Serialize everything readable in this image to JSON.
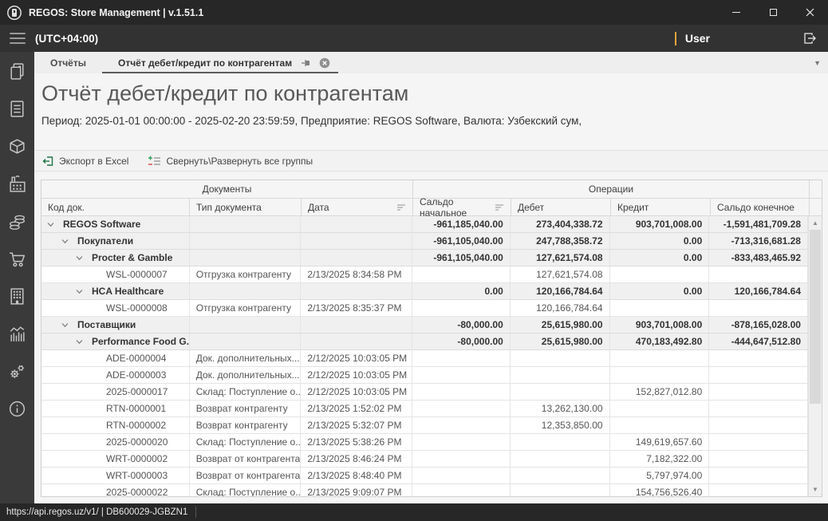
{
  "titlebar": {
    "title": "REGOS: Store Management | v.1.51.1"
  },
  "menubar": {
    "timezone": "(UTC+04:00)",
    "user": "User"
  },
  "tabs": [
    {
      "label": "Отчёты"
    },
    {
      "label": "Отчёт дебет/кредит по контрагентам",
      "active": true
    }
  ],
  "page": {
    "title": "Отчёт дебет/кредит по контрагентам",
    "subtitle": "Период: 2025-01-01 00:00:00 - 2025-02-20 23:59:59, Предприятие: REGOS Software, Валюта: Узбекский сум,"
  },
  "toolbar": {
    "export_label": "Экспорт в Excel",
    "collapse_label": "Свернуть\\Развернуть все группы"
  },
  "grid": {
    "bands": [
      "Документы",
      "Операции"
    ],
    "columns": [
      "Код док.",
      "Тип документа",
      "Дата",
      "Сальдо начальное",
      "Дебет",
      "Кредит",
      "Сальдо конечное"
    ],
    "rows": [
      {
        "level": 1,
        "group": true,
        "code": "REGOS Software",
        "doc_type": "",
        "date": "",
        "opening": "-961,185,040.00",
        "debit": "273,404,338.72",
        "credit": "903,701,008.00",
        "closing": "-1,591,481,709.28"
      },
      {
        "level": 2,
        "group": true,
        "code": "Покупатели",
        "doc_type": "",
        "date": "",
        "opening": "-961,105,040.00",
        "debit": "247,788,358.72",
        "credit": "0.00",
        "closing": "-713,316,681.28"
      },
      {
        "level": 3,
        "group": true,
        "code": "Procter & Gamble",
        "doc_type": "",
        "date": "",
        "opening": "-961,105,040.00",
        "debit": "127,621,574.08",
        "credit": "0.00",
        "closing": "-833,483,465.92"
      },
      {
        "level": 4,
        "group": false,
        "code": "WSL-0000007",
        "doc_type": "Отгрузка контрагенту",
        "date": "2/13/2025 8:34:58 PM",
        "opening": "",
        "debit": "127,621,574.08",
        "credit": "",
        "closing": ""
      },
      {
        "level": 3,
        "group": true,
        "code": "HCA Healthcare",
        "doc_type": "",
        "date": "",
        "opening": "0.00",
        "debit": "120,166,784.64",
        "credit": "0.00",
        "closing": "120,166,784.64"
      },
      {
        "level": 4,
        "group": false,
        "code": "WSL-0000008",
        "doc_type": "Отгрузка контрагенту",
        "date": "2/13/2025 8:35:37 PM",
        "opening": "",
        "debit": "120,166,784.64",
        "credit": "",
        "closing": ""
      },
      {
        "level": 2,
        "group": true,
        "code": "Поставщики",
        "doc_type": "",
        "date": "",
        "opening": "-80,000.00",
        "debit": "25,615,980.00",
        "credit": "903,701,008.00",
        "closing": "-878,165,028.00"
      },
      {
        "level": 3,
        "group": true,
        "code": "Performance Food G...",
        "doc_type": "",
        "date": "",
        "opening": "-80,000.00",
        "debit": "25,615,980.00",
        "credit": "470,183,492.80",
        "closing": "-444,647,512.80"
      },
      {
        "level": 4,
        "group": false,
        "code": "ADE-0000004",
        "doc_type": "Док. дополнительных...",
        "date": "2/12/2025 10:03:05 PM",
        "opening": "",
        "debit": "",
        "credit": "",
        "closing": ""
      },
      {
        "level": 4,
        "group": false,
        "code": "ADE-0000003",
        "doc_type": "Док. дополнительных...",
        "date": "2/12/2025 10:03:05 PM",
        "opening": "",
        "debit": "",
        "credit": "",
        "closing": ""
      },
      {
        "level": 4,
        "group": false,
        "code": "2025-0000017",
        "doc_type": "Склад: Поступление о...",
        "date": "2/12/2025 10:03:05 PM",
        "opening": "",
        "debit": "",
        "credit": "152,827,012.80",
        "closing": ""
      },
      {
        "level": 4,
        "group": false,
        "code": "RTN-0000001",
        "doc_type": "Возврат контрагенту",
        "date": "2/13/2025 1:52:02 PM",
        "opening": "",
        "debit": "13,262,130.00",
        "credit": "",
        "closing": ""
      },
      {
        "level": 4,
        "group": false,
        "code": "RTN-0000002",
        "doc_type": "Возврат контрагенту",
        "date": "2/13/2025 5:32:07 PM",
        "opening": "",
        "debit": "12,353,850.00",
        "credit": "",
        "closing": ""
      },
      {
        "level": 4,
        "group": false,
        "code": "2025-0000020",
        "doc_type": "Склад: Поступление о...",
        "date": "2/13/2025 5:38:26 PM",
        "opening": "",
        "debit": "",
        "credit": "149,619,657.60",
        "closing": ""
      },
      {
        "level": 4,
        "group": false,
        "code": "WRT-0000002",
        "doc_type": "Возврат от контрагента",
        "date": "2/13/2025 8:46:24 PM",
        "opening": "",
        "debit": "",
        "credit": "7,182,322.00",
        "closing": ""
      },
      {
        "level": 4,
        "group": false,
        "code": "WRT-0000003",
        "doc_type": "Возврат от контрагента",
        "date": "2/13/2025 8:48:40 PM",
        "opening": "",
        "debit": "",
        "credit": "5,797,974.00",
        "closing": ""
      },
      {
        "level": 4,
        "group": false,
        "code": "2025-0000022",
        "doc_type": "Склад: Поступление о...",
        "date": "2/13/2025 9:09:07 PM",
        "opening": "",
        "debit": "",
        "credit": "154,756,526.40",
        "closing": ""
      }
    ]
  },
  "statusbar": {
    "text": "https://api.regos.uz/v1/ | DB600029-JGBZN1"
  },
  "sidebar": {
    "items": [
      "copy-pages",
      "document",
      "package",
      "factory",
      "coins",
      "cart",
      "building",
      "chart",
      "gears",
      "info"
    ]
  },
  "colors": {
    "accent_orange": "#E8A33D",
    "excel_green": "#217346",
    "dark_bar": "#272727",
    "grid_group_bg": "#f0f0f0"
  }
}
